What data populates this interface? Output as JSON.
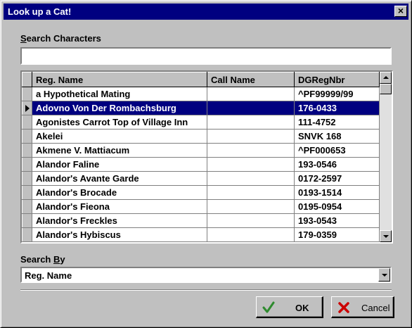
{
  "window": {
    "title": "Look up a Cat!",
    "close_label": "×"
  },
  "search": {
    "label_underlined": "S",
    "label_rest": "earch Characters",
    "value": ""
  },
  "grid": {
    "columns": [
      "Reg. Name",
      "Call Name",
      "DGRegNbr"
    ],
    "selected_index": 1,
    "rows": [
      {
        "reg_name": "a Hypothetical Mating",
        "call_name": "",
        "dg_reg_nbr": "^PF99999/99"
      },
      {
        "reg_name": "Adovno Von Der Rombachsburg",
        "call_name": "",
        "dg_reg_nbr": "176-0433"
      },
      {
        "reg_name": "Agonistes Carrot Top of Village Inn",
        "call_name": "",
        "dg_reg_nbr": "111-4752"
      },
      {
        "reg_name": "Akelei",
        "call_name": "",
        "dg_reg_nbr": "SNVK 168"
      },
      {
        "reg_name": "Akmene V. Mattiacum",
        "call_name": "",
        "dg_reg_nbr": "^PF000653"
      },
      {
        "reg_name": "Alandor Faline",
        "call_name": "",
        "dg_reg_nbr": "193-0546"
      },
      {
        "reg_name": "Alandor's Avante Garde",
        "call_name": "",
        "dg_reg_nbr": "0172-2597"
      },
      {
        "reg_name": "Alandor's Brocade",
        "call_name": "",
        "dg_reg_nbr": "0193-1514"
      },
      {
        "reg_name": "Alandor's Fieona",
        "call_name": "",
        "dg_reg_nbr": "0195-0954"
      },
      {
        "reg_name": "Alandor's Freckles",
        "call_name": "",
        "dg_reg_nbr": "193-0543"
      },
      {
        "reg_name": "Alandor's Hybiscus",
        "call_name": "",
        "dg_reg_nbr": "179-0359"
      }
    ]
  },
  "search_by": {
    "label_prefix": "Search ",
    "label_underlined": "B",
    "label_rest": "y",
    "selected": "Reg. Name"
  },
  "buttons": {
    "ok_label": "OK",
    "cancel_label": "Cancel"
  },
  "colors": {
    "title_bar": "#000080",
    "selection": "#000080",
    "face": "#c0c0c0",
    "ok_check": "#2e8b2e",
    "cancel_x": "#cc0000"
  },
  "icons": {
    "ok": "check-icon",
    "cancel": "x-icon"
  }
}
